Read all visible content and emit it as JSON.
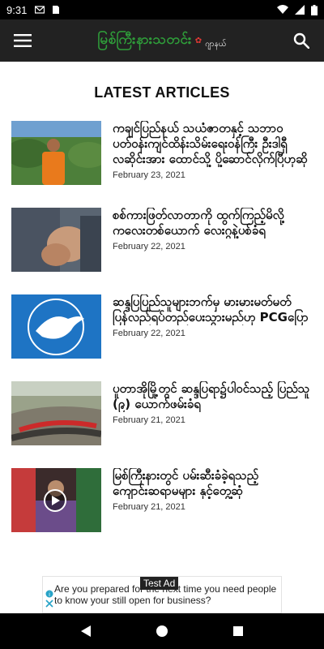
{
  "status_bar": {
    "time": "9:31",
    "icons_left": [
      "gmail-icon",
      "sim-icon"
    ],
    "icons_right": [
      "wifi-icon",
      "signal-icon",
      "battery-icon"
    ]
  },
  "app_bar": {
    "logo_main": "မြစ်ကြီးနားသတင်း",
    "logo_sub": "ဂျာနယ်",
    "menu_icon": "hamburger-icon",
    "search_icon": "search-icon"
  },
  "section_title": "LATEST ARTICLES",
  "articles": [
    {
      "title": "ကချင်ပြည်နယ် သယံဇာတနှင့် သဘာဝပတ်ဝန်းကျင်ထိန်းသိမ်းရေးဝန်ကြီး ဦးဒါရှီလဆိုင်းအား ထောင်သို့ ပို့ဆောင်လိုက်ပြီဟုဆို",
      "date": "February 23, 2021",
      "thumb": "photo-man-orange"
    },
    {
      "title": "စစ်ကားဖြတ်လာတာကို ထွက်ကြည့်မိလို့ ကလေးတစ်ယောက် လေးဂွနဲ့ပစ်ခံရ",
      "date": "February 22, 2021",
      "thumb": "photo-hands"
    },
    {
      "title": "ဆန္ဒပြပြည်သူများဘက်မှ မားမားမတ်မတ် ပြန်လည်ရပ်တည်ပေးသွားမည်ဟု PCGပြော",
      "date": "February 22, 2021",
      "thumb": "logo-dove"
    },
    {
      "title": "ပူတာအိုမြို့တွင် ဆန္ဒပြရာ၌ပါဝင်သည့် ပြည်သူ (၉) ယောက်ဖမ်းခံရ",
      "date": "February 21, 2021",
      "thumb": "photo-protest"
    },
    {
      "title": "မြစ်ကြီးနားတွင် ပမ်းဆီးခံခဲ့ရသည့် ကျောင်းဆရာမများ နှင့်တွေ့ဆုံ",
      "date": "February 21, 2021",
      "thumb": "photo-teachers-video"
    }
  ],
  "ad": {
    "label": "Test Ad",
    "text": "Are you prepared for the next time you need people to know your still open for business?"
  },
  "nav": {
    "back_icon": "back-triangle-icon",
    "home_icon": "home-circle-icon",
    "recents_icon": "recents-square-icon"
  },
  "colors": {
    "app_bar_bg": "#222222",
    "logo_green": "#2f9e3a",
    "status_bar_bg": "#000000"
  }
}
